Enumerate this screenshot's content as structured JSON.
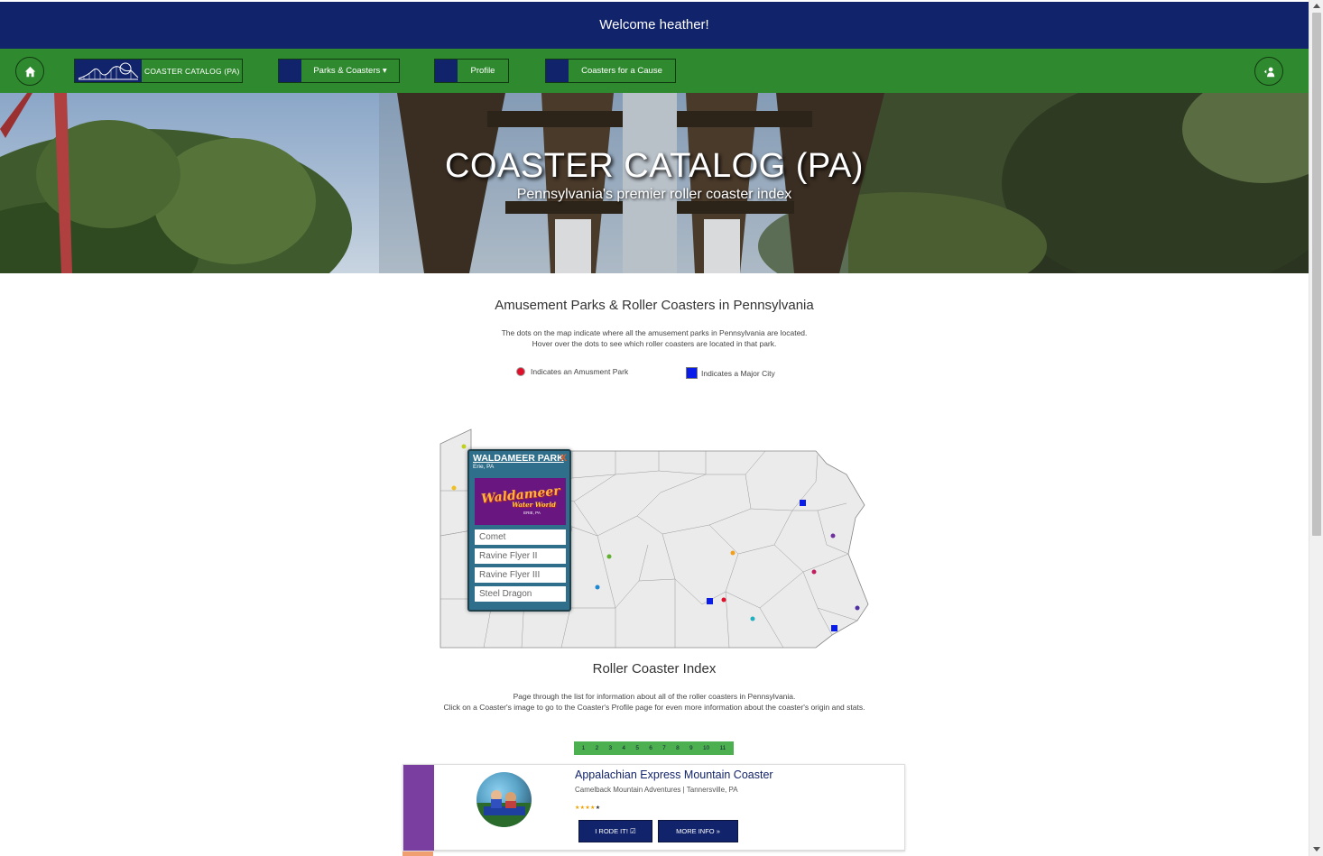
{
  "welcome": "Welcome heather!",
  "nav": {
    "brand_label": "COASTER CATALOG (PA)",
    "items": [
      {
        "label": "Parks & Coasters ▾"
      },
      {
        "label": "Profile"
      },
      {
        "label": "Coasters for a Cause"
      }
    ]
  },
  "hero": {
    "title": "COASTER CATALOG (PA)",
    "subtitle": "Pennsylvania's premier roller coaster index"
  },
  "map_section": {
    "title": "Amusement Parks & Roller Coasters in Pennsylvania",
    "desc_line1": "The dots on the map indicate where all the amusement parks in Pennsylvania are located.",
    "desc_line2": "Hover over the dots to see which roller coasters are located in that park.",
    "legend_park": "Indicates an Amusment Park",
    "legend_city": "Indicates a Major City",
    "colors": {
      "park": "#e0102a",
      "city": "#0a1de8"
    }
  },
  "popup": {
    "park_name": "WALDAMEER PARK",
    "close": "X",
    "location": "Erie, PA",
    "logo_line1": "Waldameer",
    "logo_line2": "Water World",
    "logo_line3": "ERIE, PA",
    "coasters": [
      "Comet",
      "Ravine Flyer II",
      "Ravine Flyer III",
      "Steel Dragon"
    ]
  },
  "index_section": {
    "title": "Roller Coaster Index",
    "desc_line1": "Page through the list for information about all of the roller coasters in Pennsylvania.",
    "desc_line2": "Click on a Coaster's image to go to the Coaster's Profile page for even more information about the coaster's origin and stats."
  },
  "pagination": [
    "1",
    "2",
    "3",
    "4",
    "5",
    "6",
    "7",
    "8",
    "9",
    "10",
    "11"
  ],
  "card": {
    "title": "Appalachian Express Mountain Coaster",
    "subtitle": "Camelback Mountain Adventures | Tannersville, PA",
    "rating": 4,
    "rating_max": 5,
    "stars_on": "★★★★",
    "stars_off": "★",
    "btn_rode": "I RODE IT! ☑",
    "btn_more": "MORE INFO »",
    "band_color": "#7a3ea1"
  }
}
